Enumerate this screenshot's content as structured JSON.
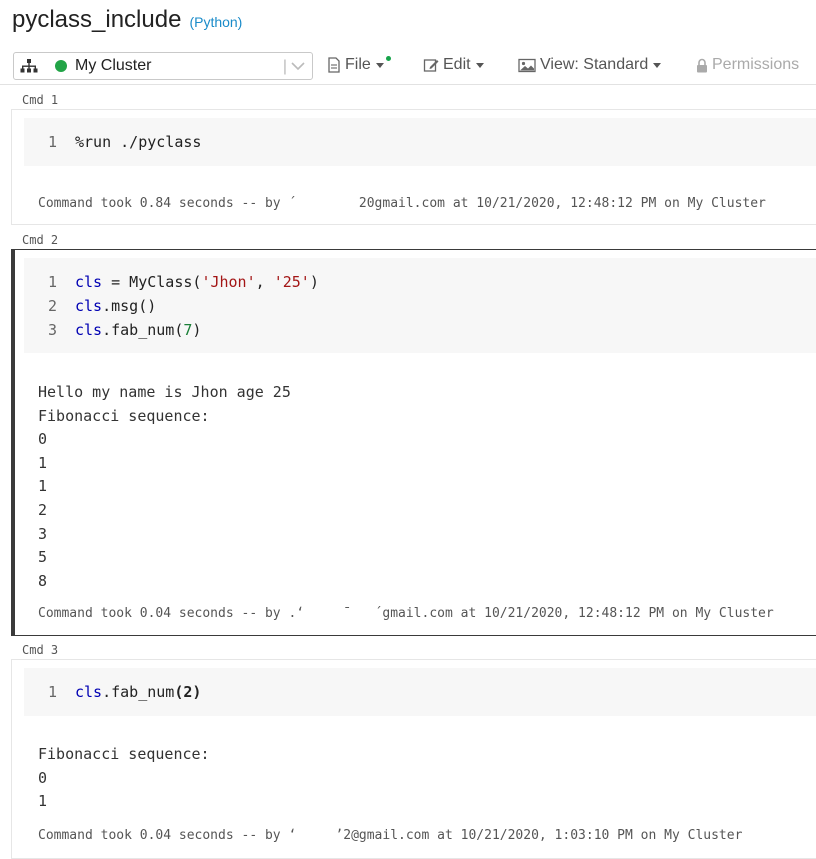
{
  "notebook": {
    "title": "pyclass_include",
    "language": "(Python)"
  },
  "toolbar": {
    "cluster_name": "My Cluster",
    "cluster_status_color": "#22a447",
    "file_label": "File",
    "edit_label": "Edit",
    "view_label": "View: Standard",
    "permissions_label": "Permissions"
  },
  "cells": [
    {
      "label": "Cmd 1",
      "lines": [
        {
          "num": "1",
          "code": "%run ./pyclass"
        }
      ],
      "output": [],
      "footer": "Command took 0.84 seconds -- by ´        20gmail.com at 10/21/2020, 12:48:12 PM on My Cluster"
    },
    {
      "label": "Cmd 2",
      "lines": [
        {
          "num": "1",
          "code": "cls = MyClass('Jhon', '25')"
        },
        {
          "num": "2",
          "code": "cls.msg()"
        },
        {
          "num": "3",
          "code": "cls.fab_num(7)"
        }
      ],
      "output": [
        "Hello my name is Jhon age 25",
        "Fibonacci sequence:",
        "0",
        "1",
        "1",
        "2",
        "3",
        "5",
        "8"
      ],
      "footer": "Command took 0.04 seconds -- by .ʻ     ¯   ´gmail.com at 10/21/2020, 12:48:12 PM on My Cluster"
    },
    {
      "label": "Cmd 3",
      "lines": [
        {
          "num": "1",
          "code": "cls.fab_num(2)"
        }
      ],
      "output": [
        "Fibonacci sequence:",
        "0",
        "1"
      ],
      "footer": "Command took 0.04 seconds -- by ʻ     ʼ2@gmail.com at 10/21/2020, 1:03:10 PM on My Cluster"
    }
  ]
}
